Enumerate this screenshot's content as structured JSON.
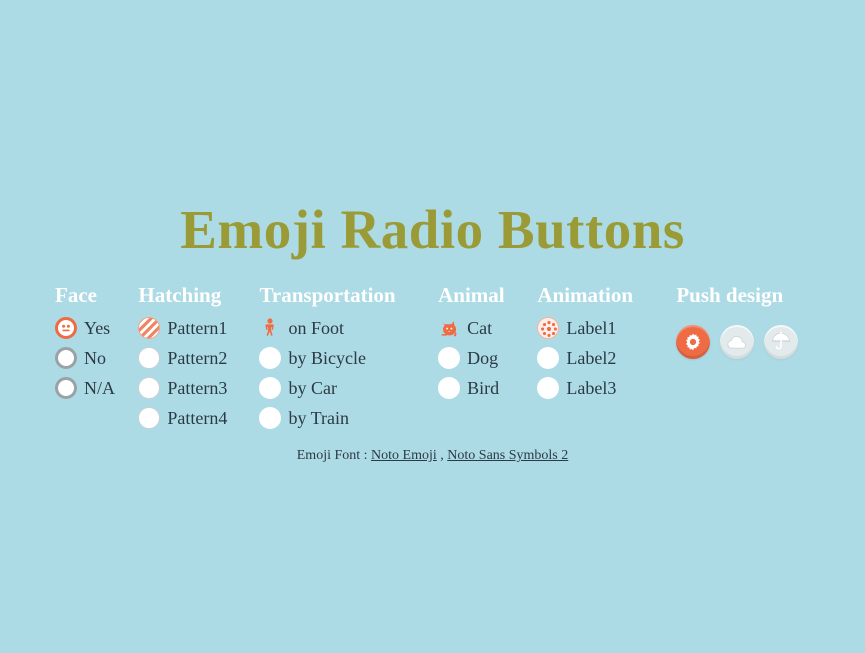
{
  "page": {
    "title": "Emoji Radio Buttons",
    "background_color": "#addbe5",
    "title_color": "#9a9b36",
    "accent_color": "#ef6b43",
    "label_color": "#2b3a44",
    "header_color": "#ffffff"
  },
  "columns": [
    {
      "header": "Face",
      "options": [
        {
          "label": "Yes",
          "selected": true,
          "marker": "smiley-face-emoji"
        },
        {
          "label": "No",
          "selected": false,
          "marker": "radio-ring-grey"
        },
        {
          "label": "N/A",
          "selected": false,
          "marker": "radio-ring-grey"
        }
      ]
    },
    {
      "header": "Hatching",
      "options": [
        {
          "label": "Pattern1",
          "selected": true,
          "marker": "hatched-circle"
        },
        {
          "label": "Pattern2",
          "selected": false,
          "marker": "radio-thin"
        },
        {
          "label": "Pattern3",
          "selected": false,
          "marker": "radio-thin"
        },
        {
          "label": "Pattern4",
          "selected": false,
          "marker": "radio-thin"
        }
      ]
    },
    {
      "header": "Transportation",
      "options": [
        {
          "label": "on Foot",
          "selected": true,
          "marker": "pedestrian-emoji"
        },
        {
          "label": "by Bicycle",
          "selected": false,
          "marker": "radio-plain"
        },
        {
          "label": "by Car",
          "selected": false,
          "marker": "radio-plain"
        },
        {
          "label": "by Train",
          "selected": false,
          "marker": "radio-plain"
        }
      ]
    },
    {
      "header": "Animal",
      "options": [
        {
          "label": "Cat",
          "selected": true,
          "marker": "cat-emoji"
        },
        {
          "label": "Dog",
          "selected": false,
          "marker": "radio-plain"
        },
        {
          "label": "Bird",
          "selected": false,
          "marker": "radio-plain"
        }
      ]
    },
    {
      "header": "Animation",
      "options": [
        {
          "label": "Label1",
          "selected": true,
          "marker": "burst-circle"
        },
        {
          "label": "Label2",
          "selected": false,
          "marker": "radio-plain"
        },
        {
          "label": "Label3",
          "selected": false,
          "marker": "radio-plain"
        }
      ]
    }
  ],
  "push_design": {
    "header": "Push design",
    "buttons": [
      {
        "icon": "sun-gear-icon",
        "state": "on"
      },
      {
        "icon": "cloud-icon",
        "state": "off"
      },
      {
        "icon": "umbrella-icon",
        "state": "off"
      }
    ]
  },
  "footer": {
    "prefix": "Emoji Font : ",
    "link1": "Noto Emoji",
    "separator": " , ",
    "link2": "Noto Sans Symbols 2"
  }
}
